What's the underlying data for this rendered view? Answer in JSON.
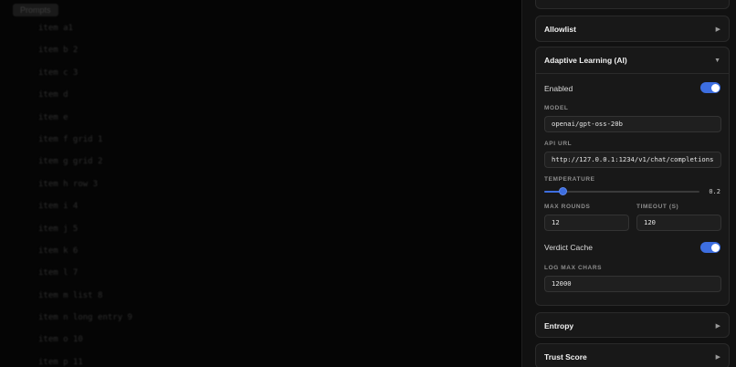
{
  "background": {
    "tag": "Prompts",
    "items": [
      "item a1",
      "item b 2",
      "item c 3",
      "item d",
      "item e",
      "item f grid 1",
      "item g grid 2",
      "item h row 3",
      "item i 4",
      "item j 5",
      "item k 6",
      "item l 7",
      "item m list 8",
      "item n long entry 9",
      "item o 10",
      "item p 11"
    ]
  },
  "panel": {
    "top_card": {},
    "allowlist": {
      "title": "Allowlist",
      "chevron": "▶"
    },
    "adaptive": {
      "title": "Adaptive Learning (AI)",
      "chevron": "▼",
      "enabled_label": "Enabled",
      "enabled": true,
      "model_label": "MODEL",
      "model_value": "openai/gpt-oss-20b",
      "api_url_label": "API URL",
      "api_url_value": "http://127.0.0.1:1234/v1/chat/completions",
      "temperature_label": "TEMPERATURE",
      "temperature_value": "0.2",
      "temperature_fraction": 0.12,
      "max_rounds_label": "MAX ROUNDS",
      "max_rounds_value": "12",
      "timeout_label": "TIMEOUT (S)",
      "timeout_value": "120",
      "verdict_cache_label": "Verdict Cache",
      "verdict_cache": true,
      "log_max_chars_label": "LOG MAX CHARS",
      "log_max_chars_value": "12000"
    },
    "entropy": {
      "title": "Entropy",
      "chevron": "▶"
    },
    "trust_score": {
      "title": "Trust Score",
      "chevron": "▶"
    }
  },
  "colors": {
    "accent": "#3d6ee0",
    "panel_bg": "#111111",
    "card_bg": "#181818"
  }
}
